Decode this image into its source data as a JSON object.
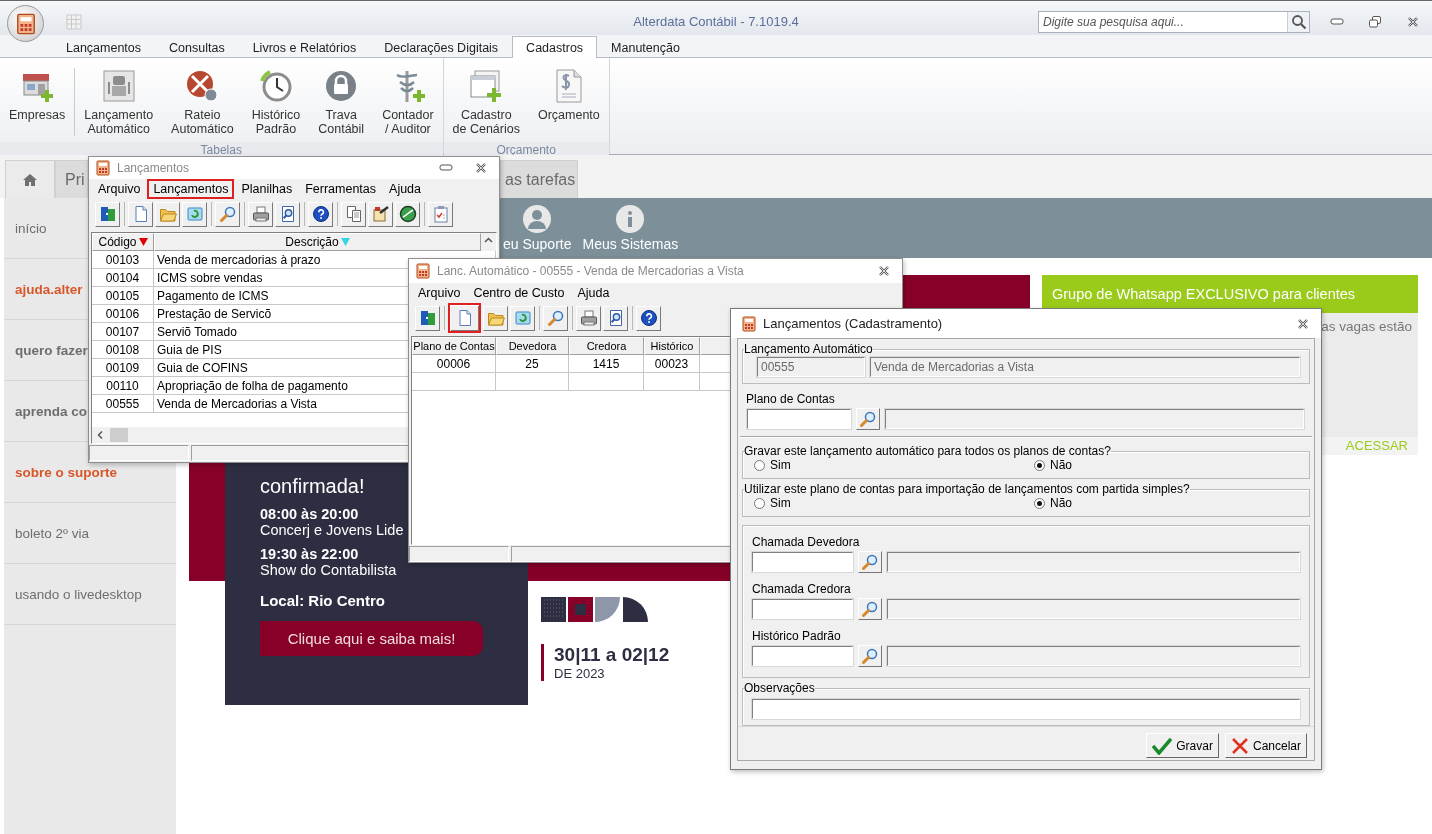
{
  "window": {
    "title": "Alterdata Contábil - 7.1019.4"
  },
  "search": {
    "placeholder": "Digite sua pesquisa aqui..."
  },
  "ribbon": {
    "tabs": [
      {
        "label": "Lançamentos",
        "selected": false
      },
      {
        "label": "Consultas",
        "selected": false
      },
      {
        "label": "Livros e Relatórios",
        "selected": false
      },
      {
        "label": "Declarações Digitais",
        "selected": false
      },
      {
        "label": "Cadastros",
        "selected": true
      },
      {
        "label": "Manutenção",
        "selected": false
      }
    ],
    "groups": [
      {
        "label": "Tabelas",
        "sections": [
          [
            {
              "kind": "company",
              "label": "Empresas"
            }
          ],
          [
            {
              "kind": "robot",
              "label": "Lançamento\nAutomático"
            },
            {
              "kind": "split",
              "label": "Rateio\nAutomático"
            },
            {
              "kind": "history",
              "label": "Histórico\nPadrão"
            },
            {
              "kind": "lock",
              "label": "Trava\nContábil"
            },
            {
              "kind": "caduceus",
              "label": "Contador\n/ Auditor"
            }
          ]
        ]
      },
      {
        "label": "Orçamento",
        "sections": [
          [
            {
              "kind": "scenario",
              "label": "Cadastro\nde Cenários"
            },
            {
              "kind": "budget",
              "label": "Orçamento"
            }
          ]
        ]
      }
    ]
  },
  "portal": {
    "tabs": [
      {
        "kind": "home",
        "selected": true
      },
      {
        "kind": "text",
        "label": "Pri",
        "selected": false
      },
      {
        "kind": "text",
        "label": "as tarefas",
        "selected": false
      }
    ],
    "links": [
      {
        "kind": "person",
        "label": "eu Suporte"
      },
      {
        "kind": "info",
        "label": "Meus Sistemas"
      }
    ],
    "sidebar": [
      {
        "kind": "plain",
        "label": "início"
      },
      {
        "kind": "accent",
        "label": "ajuda.alter"
      },
      {
        "kind": "bold",
        "label": "quero fazer"
      },
      {
        "kind": "bold",
        "label": "aprenda co"
      },
      {
        "kind": "accent",
        "label": "sobre o suporte"
      },
      {
        "kind": "plain",
        "label": "boleto 2º via"
      },
      {
        "kind": "plain",
        "label": "usando o livedesktop"
      }
    ],
    "banner": {
      "heading": "confirmada!",
      "schedule": [
        {
          "time": "08:00 às 20:00",
          "event": "Concerj e Jovens Lide"
        },
        {
          "time": "19:30 às 22:00",
          "event": "Show do Contabilista"
        }
      ],
      "location": "Local: Rio Centro",
      "button": "Clique aqui e saiba mais!",
      "dates": "30|11 a 02|12",
      "year": "DE 2023"
    },
    "promo": {
      "title": "Grupo de Whatsapp EXCLUSIVO para clientes",
      "text": "as vagas estão",
      "action": "ACESSAR"
    }
  },
  "list_window": {
    "title": "Lançamentos",
    "menu": [
      {
        "label": "Arquivo",
        "highlighted": false
      },
      {
        "label": "Lançamentos",
        "highlighted": true
      },
      {
        "label": "Planilhas",
        "highlighted": false
      },
      {
        "label": "Ferramentas",
        "highlighted": false
      },
      {
        "label": "Ajuda",
        "highlighted": false
      }
    ],
    "toolbar": [
      [
        {
          "kind": "exit",
          "highlighted": false
        }
      ],
      [
        {
          "kind": "new",
          "highlighted": false
        },
        {
          "kind": "open",
          "highlighted": false
        },
        {
          "kind": "refresh",
          "highlighted": false
        }
      ],
      [
        {
          "kind": "find",
          "highlighted": false
        }
      ],
      [
        {
          "kind": "print",
          "highlighted": false
        },
        {
          "kind": "preview",
          "highlighted": false
        }
      ],
      [
        {
          "kind": "help",
          "highlighted": false
        }
      ],
      [
        {
          "kind": "copy",
          "highlighted": false
        },
        {
          "kind": "tools",
          "highlighted": false
        },
        {
          "kind": "globe",
          "highlighted": false
        }
      ],
      [
        {
          "kind": "check",
          "highlighted": false
        }
      ]
    ],
    "columns": [
      {
        "label": "Código",
        "color": "#e00000"
      },
      {
        "label": "Descrição",
        "color": "#33d6e0"
      }
    ],
    "rows": [
      {
        "code": "00103",
        "description": "Venda de mercadorias à prazo"
      },
      {
        "code": "00104",
        "description": "ICMS sobre vendas"
      },
      {
        "code": "00105",
        "description": "Pagamento de ICMS"
      },
      {
        "code": "00106",
        "description": "Prestação de Servicõ"
      },
      {
        "code": "00107",
        "description": "Serviõ Tomado"
      },
      {
        "code": "00108",
        "description": "Guia de PIS"
      },
      {
        "code": "00109",
        "description": "Guia de COFINS"
      },
      {
        "code": "00110",
        "description": "Apropriação de folha de pagamento"
      },
      {
        "code": "00555",
        "description": "Venda de Mercadorias a Vista"
      }
    ]
  },
  "auto_window": {
    "title": "Lanc. Automático - 00555 - Venda de Mercadorias a Vista",
    "menu": [
      {
        "label": "Arquivo",
        "highlighted": false
      },
      {
        "label": "Centro de Custo",
        "highlighted": false
      },
      {
        "label": "Ajuda",
        "highlighted": false
      }
    ],
    "toolbar": [
      [
        {
          "kind": "exit",
          "highlighted": false
        }
      ],
      [
        {
          "kind": "new",
          "highlighted": true
        },
        {
          "kind": "open",
          "highlighted": false
        },
        {
          "kind": "refresh",
          "highlighted": false
        }
      ],
      [
        {
          "kind": "find",
          "highlighted": false
        }
      ],
      [
        {
          "kind": "print",
          "highlighted": false
        },
        {
          "kind": "preview",
          "highlighted": false
        }
      ],
      [
        {
          "kind": "help",
          "highlighted": false
        }
      ]
    ],
    "columns": [
      "Plano de Contas",
      "Devedora",
      "Credora",
      "Histórico"
    ],
    "rows": [
      [
        "00006",
        "25",
        "1415",
        "00023"
      ]
    ]
  },
  "form_window": {
    "title": "Lançamentos (Cadastramento)",
    "entry": {
      "label": "Lançamento Automático",
      "code": "00555",
      "description": "Venda de Mercadorias a Vista"
    },
    "account": {
      "label": "Plano de Contas"
    },
    "questions": [
      {
        "label": "Gravar este lançamento automático para todos os planos de contas?",
        "options": [
          {
            "label": "Sim",
            "selected": false
          },
          {
            "label": "Não",
            "selected": true
          }
        ]
      },
      {
        "label": "Utilizar este plano de contas para importação de lançamentos com partida simples?",
        "options": [
          {
            "label": "Sim",
            "selected": false
          },
          {
            "label": "Não",
            "selected": true
          }
        ]
      }
    ],
    "lookups": [
      {
        "label": "Chamada Devedora"
      },
      {
        "label": "Chamada Credora"
      },
      {
        "label": "Histórico Padrão"
      }
    ],
    "notes": {
      "label": "Observações"
    },
    "buttons": [
      {
        "kind": "save",
        "label": "Gravar"
      },
      {
        "kind": "cancel",
        "label": "Cancelar"
      }
    ]
  }
}
